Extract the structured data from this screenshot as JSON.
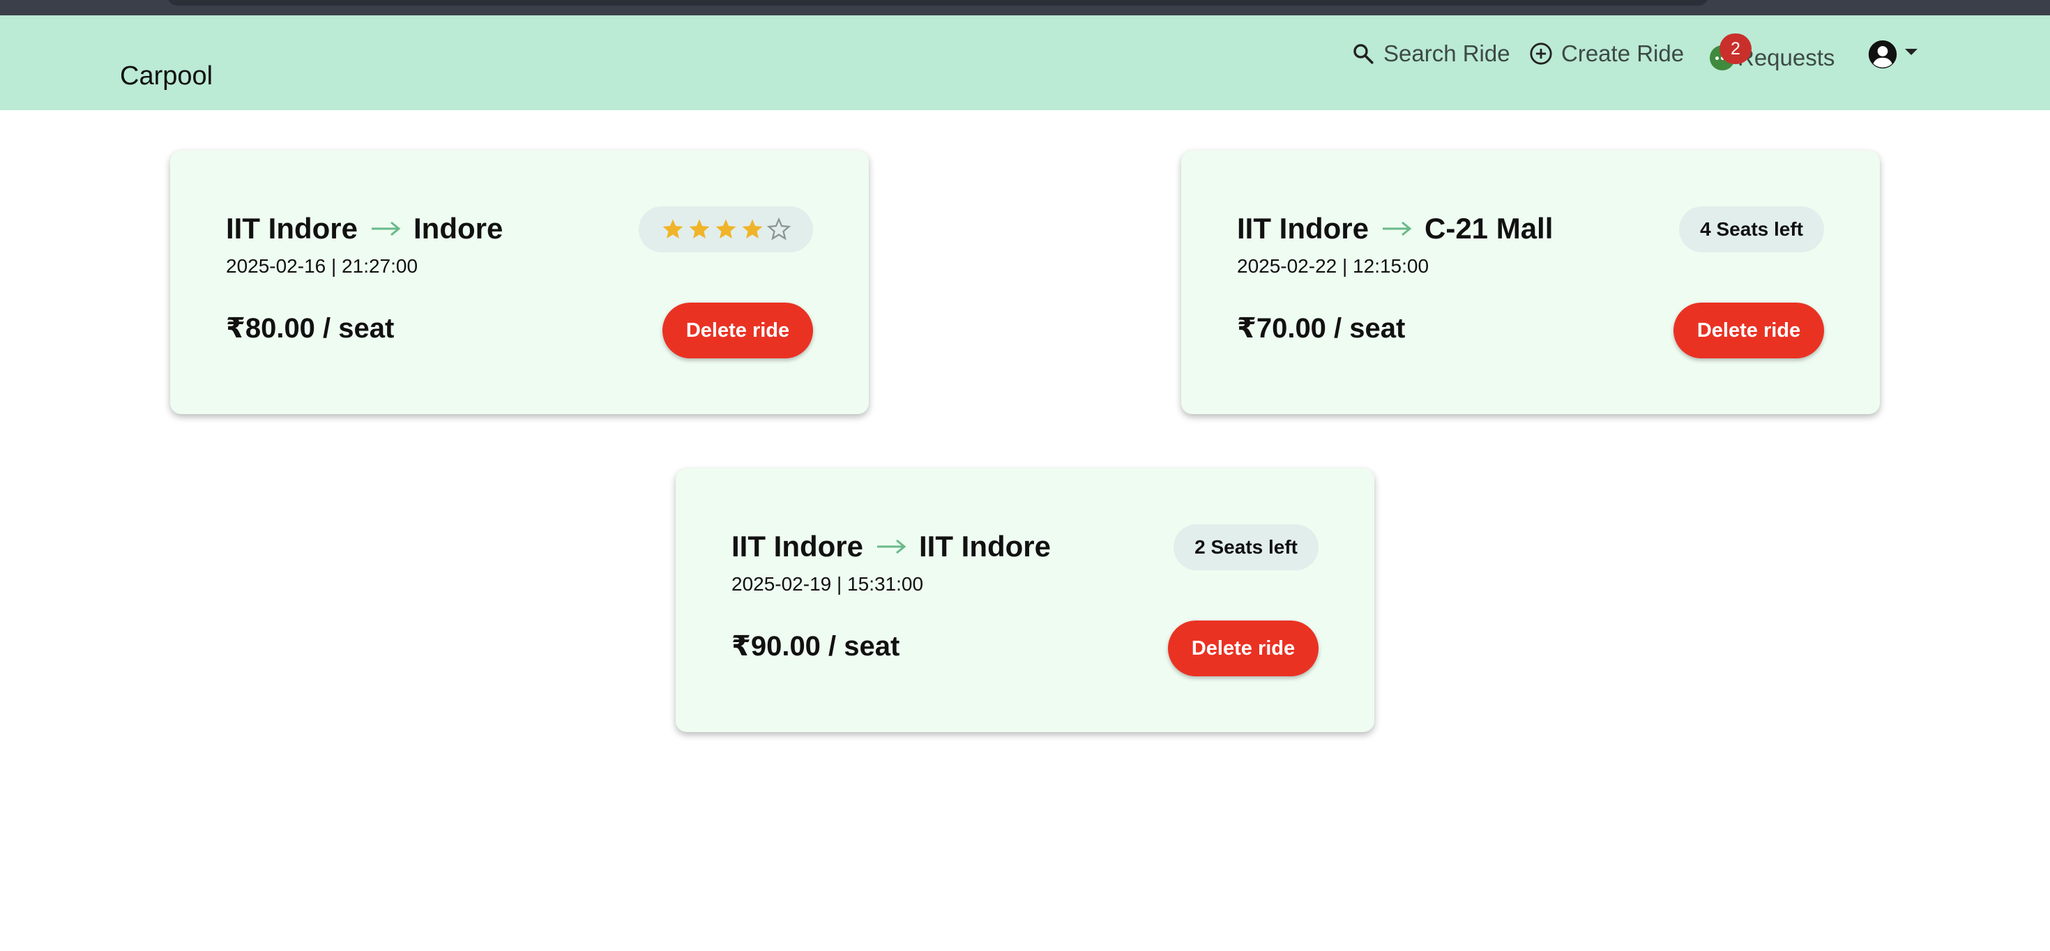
{
  "app": {
    "brand": "Carpool"
  },
  "nav": {
    "search_label": "Search Ride",
    "create_label": "Create Ride",
    "requests_label": "Requests",
    "requests_count": "2"
  },
  "rides": [
    {
      "from": "IIT Indore",
      "to": "Indore",
      "datetime": "2025-02-16 | 21:27:00",
      "price": "₹80.00 / seat",
      "rating": 4,
      "rating_max": 5,
      "delete_label": "Delete ride"
    },
    {
      "from": "IIT Indore",
      "to": "C-21 Mall",
      "datetime": "2025-02-22 | 12:15:00",
      "price": "₹70.00 / seat",
      "seats_label": "4 Seats left",
      "delete_label": "Delete ride"
    },
    {
      "from": "IIT Indore",
      "to": "IIT Indore",
      "datetime": "2025-02-19 | 15:31:00",
      "price": "₹90.00 / seat",
      "seats_label": "2 Seats left",
      "delete_label": "Delete ride"
    }
  ],
  "colors": {
    "navbar": "#bbead5",
    "card": "#effcf1",
    "delete": "#ea3223",
    "badge": "#c9302c",
    "star": "#f0b429"
  },
  "icons": {
    "search": "search-icon",
    "create": "plus-circle-icon",
    "requests": "chat-dots-icon",
    "user": "user-circle-icon",
    "arrow": "arrow-right-icon",
    "star": "star-icon"
  }
}
